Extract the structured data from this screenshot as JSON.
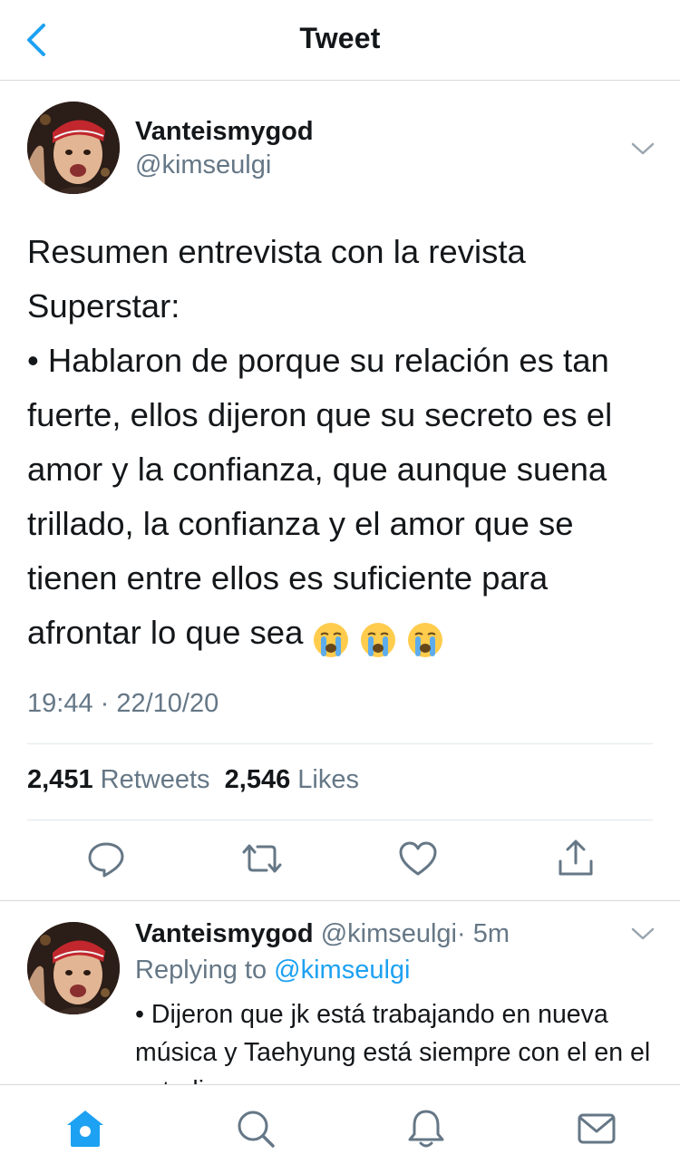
{
  "header": {
    "title": "Tweet"
  },
  "tweet": {
    "author_name": "Vanteismygod",
    "author_handle": "@kimseulgi",
    "text_line1": "Resumen entrevista con la revista Superstar:",
    "text_line2": "• Hablaron de porque su relación es tan fuerte, ellos dijeron que su secreto es el amor y la confianza, que aunque suena trillado, la confianza y el amor que se tienen entre ellos es suficiente para afrontar lo que sea",
    "emoji": "loudly-crying-face",
    "emoji_count": 3,
    "timestamp": "19:44 · 22/10/20",
    "retweets_count": "2,451",
    "retweets_label": "Retweets",
    "likes_count": "2,546",
    "likes_label": "Likes"
  },
  "actions": [
    "reply-icon",
    "retweet-icon",
    "like-icon",
    "share-icon"
  ],
  "reply": {
    "author_name": "Vanteismygod",
    "author_handle": "@kimseulgi",
    "age": "· 5m",
    "replying_prefix": "Replying to",
    "replying_to": "@kimseulgi",
    "text": "• Dijeron que jk está trabajando en nueva música y Taehyung está siempre con el en el estudio"
  },
  "tabbar": [
    "home-icon",
    "search-icon",
    "notifications-icon",
    "messages-icon"
  ],
  "colors": {
    "accent": "#1da1f2",
    "text": "#14171a",
    "secondary": "#657786",
    "divider": "#e1e8ed"
  }
}
